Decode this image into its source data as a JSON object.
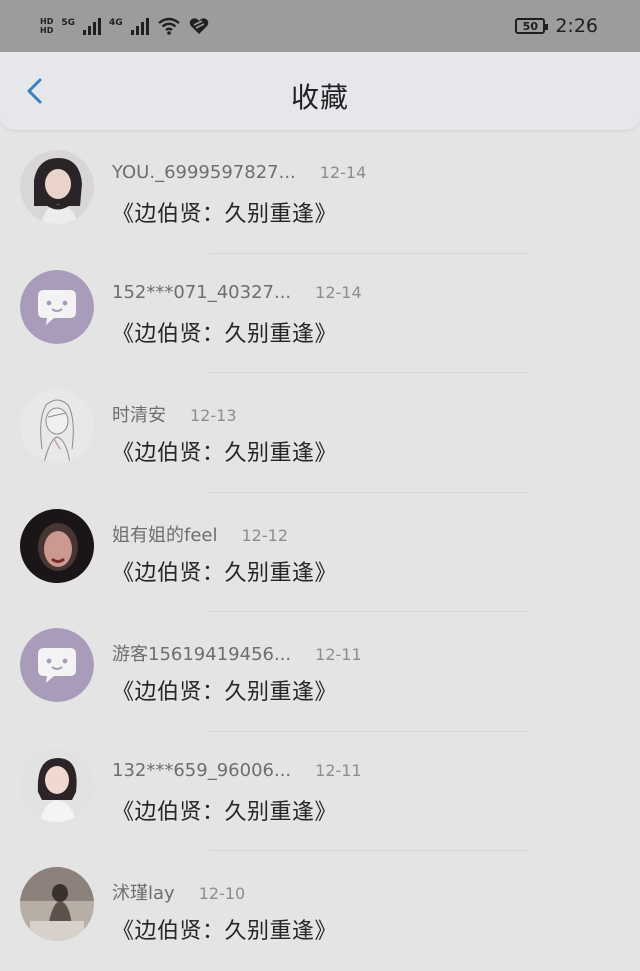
{
  "statusbar": {
    "net1_top": "HD",
    "net1_bot": "HD",
    "sig1_label": "5G",
    "sig2_label": "4G",
    "battery": "50",
    "time": "2:26"
  },
  "header": {
    "title": "收藏"
  },
  "items": [
    {
      "user": "YOU._6999597827...",
      "date": "12-14",
      "title": "《边伯贤：久别重逢》",
      "avatar": "photo-portrait-icon"
    },
    {
      "user": "152***071_40327...",
      "date": "12-14",
      "title": "《边伯贤：久别重逢》",
      "avatar": "chat-bubble-icon"
    },
    {
      "user": "时清安",
      "date": "12-13",
      "title": "《边伯贤：久别重逢》",
      "avatar": "sketch-girl-icon"
    },
    {
      "user": "姐有姐的feel",
      "date": "12-12",
      "title": "《边伯贤：久别重逢》",
      "avatar": "photo-face-icon"
    },
    {
      "user": "游客15619419456...",
      "date": "12-11",
      "title": "《边伯贤：久别重逢》",
      "avatar": "chat-bubble-icon"
    },
    {
      "user": "132***659_96006...",
      "date": "12-11",
      "title": "《边伯贤：久别重逢》",
      "avatar": "photo-portrait-icon"
    },
    {
      "user": "沭瑾lay",
      "date": "12-10",
      "title": "《边伯贤：久别重逢》",
      "avatar": "photo-room-icon"
    }
  ]
}
